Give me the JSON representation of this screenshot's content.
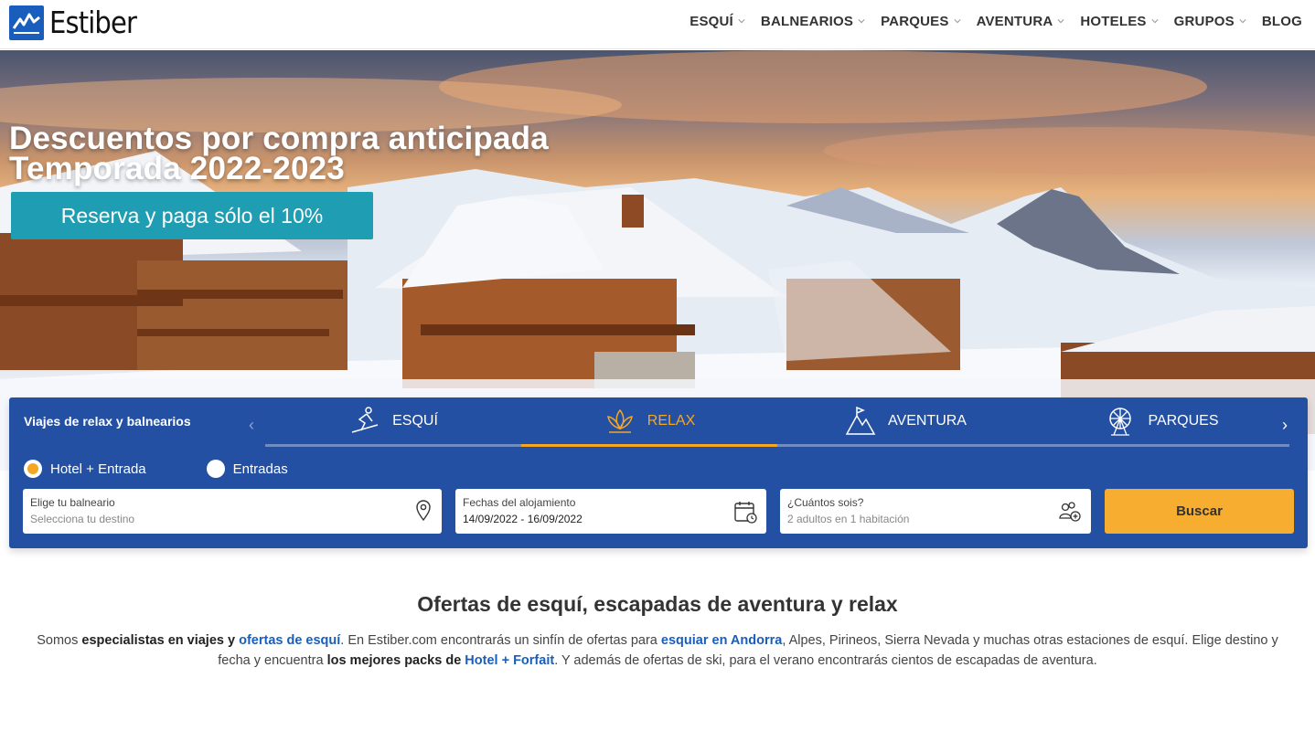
{
  "brand": {
    "name": "Estiber",
    "color": "#1a5ebd"
  },
  "nav": [
    {
      "label": "ESQUÍ",
      "dropdown": true
    },
    {
      "label": "BALNEARIOS",
      "dropdown": true
    },
    {
      "label": "PARQUES",
      "dropdown": true
    },
    {
      "label": "AVENTURA",
      "dropdown": true
    },
    {
      "label": "HOTELES",
      "dropdown": true
    },
    {
      "label": "GRUPOS",
      "dropdown": true
    },
    {
      "label": "BLOG",
      "dropdown": false
    }
  ],
  "hero": {
    "title_line1": "Descuentos por compra anticipada",
    "title_line2": "Temporada 2022-2023",
    "cta": "Reserva y paga sólo el 10%",
    "cta_color": "#1f9db3"
  },
  "search": {
    "title": "Viajes de relax y balnearios",
    "tabs": [
      {
        "label": "ESQUÍ",
        "icon": "skier-icon",
        "active": false
      },
      {
        "label": "RELAX",
        "icon": "lotus-icon",
        "active": true
      },
      {
        "label": "AVENTURA",
        "icon": "mountain-flag-icon",
        "active": false
      },
      {
        "label": "PARQUES",
        "icon": "ferris-wheel-icon",
        "active": false
      }
    ],
    "radio_options": [
      {
        "label": "Hotel + Entrada",
        "selected": true
      },
      {
        "label": "Entradas",
        "selected": false
      }
    ],
    "destination": {
      "label": "Elige tu balneario",
      "placeholder": "Selecciona tu destino",
      "icon": "location-pin-icon"
    },
    "dates": {
      "label": "Fechas del alojamiento",
      "value": "14/09/2022 - 16/09/2022",
      "icon": "calendar-icon"
    },
    "guests": {
      "label": "¿Cuántos sois?",
      "placeholder": "2 adultos en 1 habitación",
      "icon": "add-people-icon"
    },
    "submit": "Buscar",
    "panel_color": "#2450a3",
    "accent_color": "#f5a623"
  },
  "content": {
    "title": "Ofertas de esquí, escapadas de aventura y relax",
    "p1": "Somos ",
    "p2": "especialistas en viajes y ",
    "p3": "ofertas de esquí",
    "p4": ". En Estiber.com encontrarás un sinfín de ofertas para ",
    "p5": "esquiar en Andorra",
    "p6": ", Alpes, Pirineos, Sierra Nevada y muchas otras estaciones de esquí. Elige destino y fecha y encuentra ",
    "p7": "los mejores packs de ",
    "p8": "Hotel + Forfait",
    "p9": ". Y además de ofertas de ski, para el verano encontrarás cientos de escapadas de aventura."
  }
}
